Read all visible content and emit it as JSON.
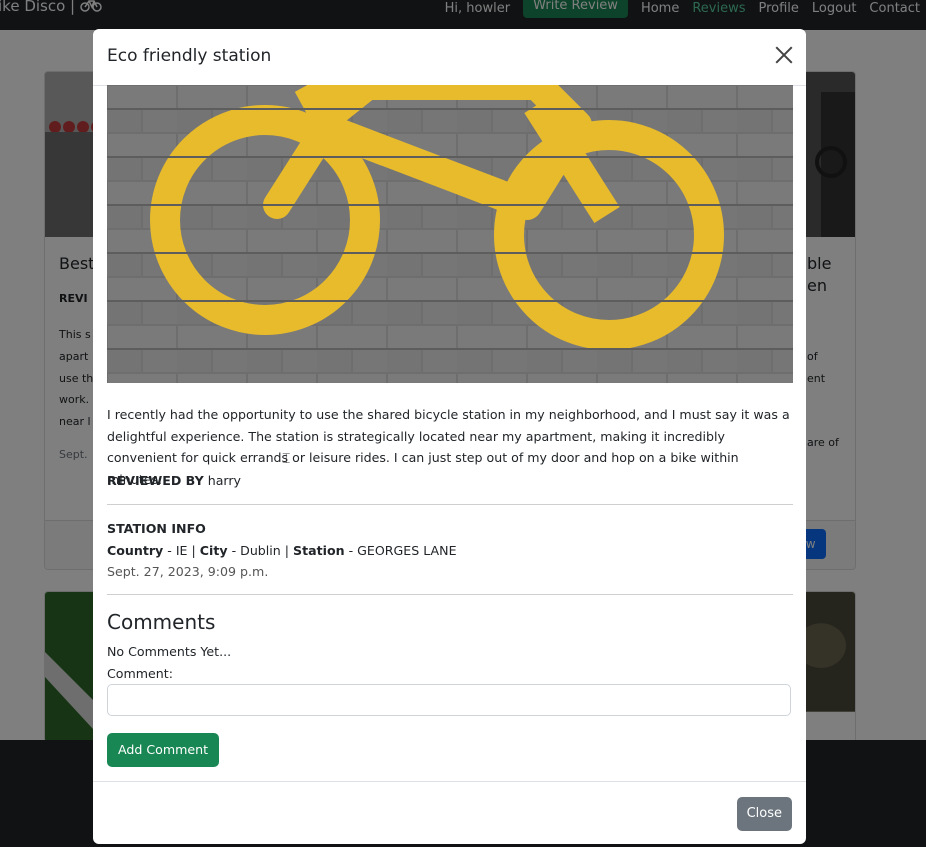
{
  "nav": {
    "brand": "ike Disco |",
    "greeting": "Hi, howler",
    "write_review": "Write Review",
    "home": "Home",
    "reviews": "Reviews",
    "profile": "Profile",
    "logout": "Logout",
    "contact": "Contact"
  },
  "background_cards": {
    "left": {
      "title": "Best",
      "reviewed_label": "REVI",
      "lines": [
        "This s",
        "apart",
        "use th",
        "work.",
        "near l"
      ],
      "date": "Sept."
    },
    "right": {
      "title_lines": [
        "ble",
        "en"
      ],
      "lines": [
        "of",
        "ent",
        "are of"
      ],
      "button": "iew"
    }
  },
  "modal": {
    "title": "Eco friendly station",
    "review_text": "I recently had the opportunity to use the shared bicycle station in my neighborhood, and I must say it was a delightful experience. The station is strategically located near my apartment, making it incredibly convenient for quick errands or leisure rides. I can just step out of my door and hop on a bike within minutes.",
    "reviewed_by_label": "REVIEWED BY",
    "reviewer": "harry",
    "station_info_heading": "STATION INFO",
    "country_label": "Country",
    "country": "IE",
    "city_label": "City",
    "city": "Dublin",
    "station_label": "Station",
    "station": "GEORGES LANE",
    "date": "Sept. 27, 2023, 9:09 p.m.",
    "comments_heading": "Comments",
    "no_comments": "No Comments Yet...",
    "comment_label": "Comment:",
    "comment_value": "",
    "add_comment": "Add Comment",
    "close": "Close"
  },
  "colors": {
    "success": "#198754",
    "secondary": "#6c757d",
    "primary": "#0d6efd",
    "navbar": "#212529",
    "paint_yellow": "#e8bb2c",
    "paver_gray": "#6b6b6b"
  }
}
